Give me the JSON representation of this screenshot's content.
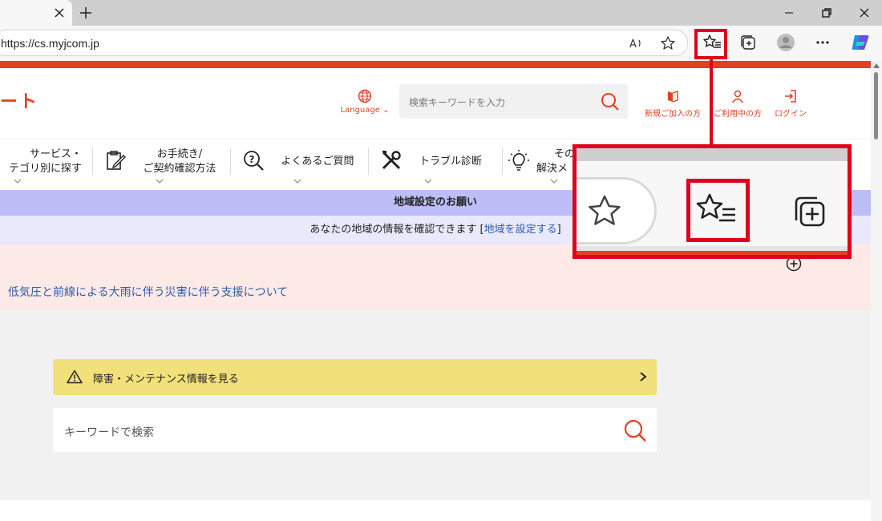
{
  "browser": {
    "url": "https://cs.myjcom.jp",
    "icons": [
      "close-icon",
      "plus-icon",
      "read-aloud-icon",
      "star-icon",
      "favorites-icon",
      "collections-icon",
      "profile-icon",
      "more-icon",
      "copilot-icon"
    ],
    "highlight_color": "#e0001a"
  },
  "header": {
    "logo_fragment": "ート",
    "language_label": "Language",
    "search_placeholder": "検索キーワードを入力",
    "actions": [
      {
        "label": "新規ご加入の方"
      },
      {
        "label": "ご利用中の方"
      },
      {
        "label": "ログイン"
      }
    ],
    "brand_color": "#e3401f"
  },
  "nav": {
    "items": [
      {
        "label_line1": "サービス・",
        "label_line2": "テゴリ別に探す"
      },
      {
        "label_line1": "お手続き/",
        "label_line2": "ご契約確認方法"
      },
      {
        "label_line1": "よくあるご質問"
      },
      {
        "label_line1": "トラブル診断"
      },
      {
        "label_line1": "その",
        "label_line2": "解決メ"
      }
    ]
  },
  "region": {
    "title": "地域設定のお願い",
    "message": "あなたの地域の情報を確認できます [",
    "link": "地域を設定する",
    "suffix": "]"
  },
  "alert": {
    "text": "低気圧と前線による大雨に伴う災害に伴う支援について"
  },
  "maintenance": {
    "text": "障害・メンテナンス情報を見る"
  },
  "keyword_search": {
    "placeholder": "キーワードで検索"
  }
}
